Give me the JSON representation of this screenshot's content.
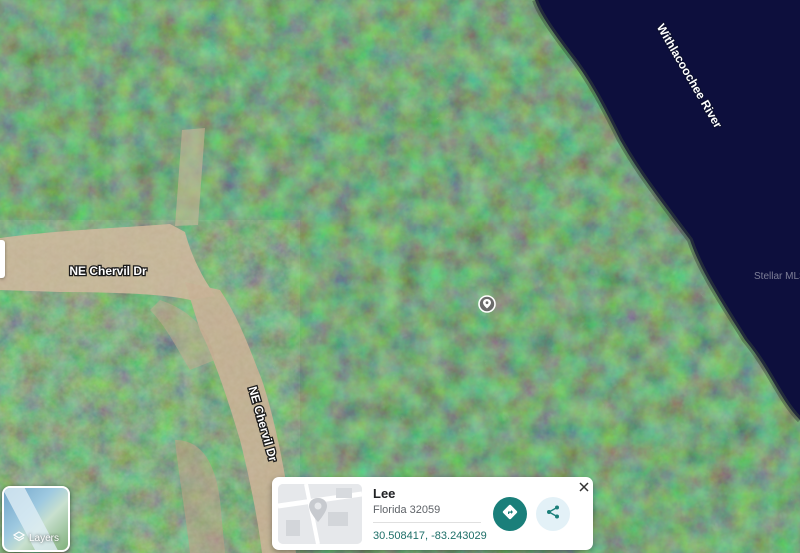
{
  "map": {
    "roads": [
      {
        "name": "NE Chervil Dr"
      },
      {
        "name": "NE Chervil Dr"
      }
    ],
    "water_label": "Withlacoochee River",
    "watermark": "Stellar MLS",
    "colors": {
      "forest": "#2f5a33",
      "river": "#0d0f3d",
      "road": "#c9b497"
    },
    "marker_icon": "location-pin-icon"
  },
  "layers_button": {
    "label": "Layers",
    "icon": "layers-icon"
  },
  "info_card": {
    "title": "Lee",
    "subtitle": "Florida 32059",
    "coordinates": "30.508417, -83.243029",
    "directions_icon": "directions-icon",
    "share_icon": "share-icon",
    "close_icon": "close-icon",
    "accent": "#1a7f7a"
  }
}
